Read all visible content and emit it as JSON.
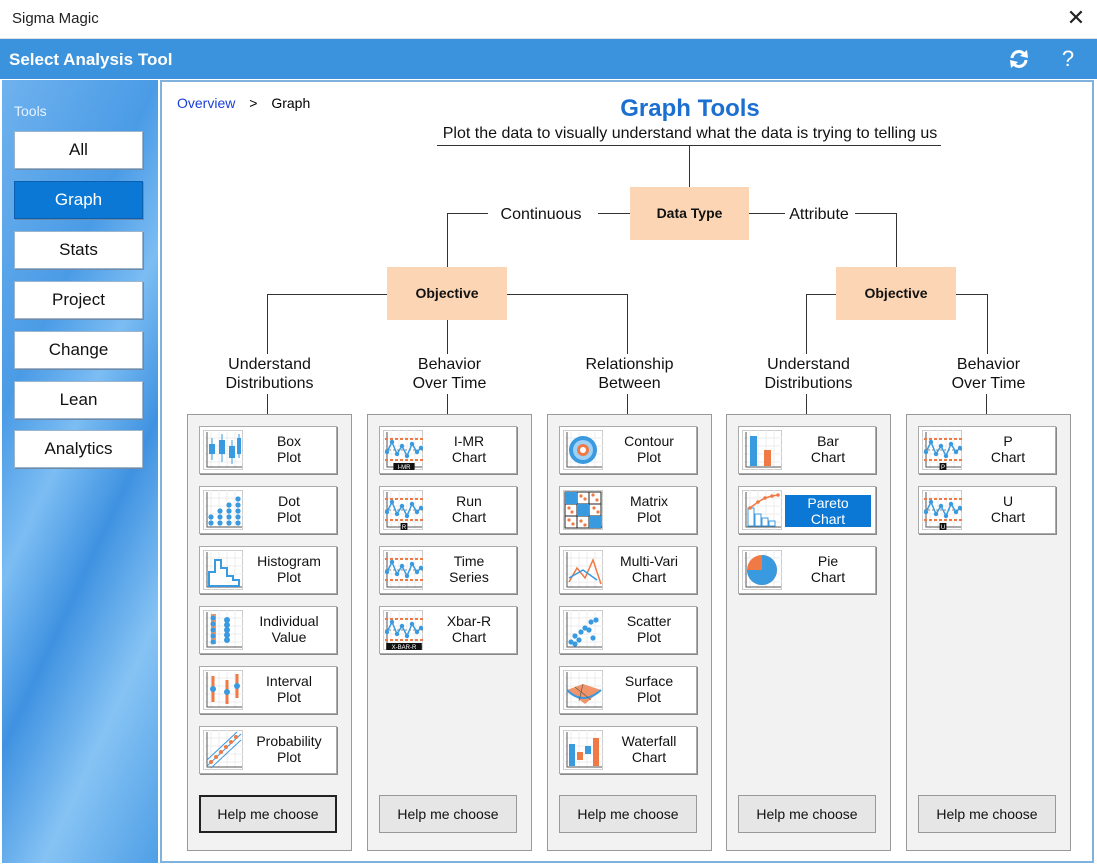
{
  "window": {
    "title": "Sigma Magic",
    "close_glyph": "✕"
  },
  "header": {
    "title": "Select Analysis Tool",
    "refresh_glyph": "⟳",
    "help_glyph": "?"
  },
  "sidebar": {
    "label": "Tools",
    "items": [
      {
        "label": "All"
      },
      {
        "label": "Graph",
        "active": true
      },
      {
        "label": "Stats"
      },
      {
        "label": "Project"
      },
      {
        "label": "Change"
      },
      {
        "label": "Lean"
      },
      {
        "label": "Analytics"
      }
    ]
  },
  "breadcrumb": {
    "root": "Overview",
    "separator": ">",
    "current": "Graph"
  },
  "main": {
    "title": "Graph Tools",
    "subtitle": "Plot the data to visually understand what the data is trying to telling us",
    "data_type": "Data Type",
    "continuous": "Continuous",
    "attribute": "Attribute",
    "objective": "Objective",
    "help_label": "Help me choose",
    "colors": {
      "accent": "#3b93dd",
      "box": "#fcd6b4",
      "selected": "#0a78d4",
      "title": "#1a6fd0"
    },
    "groups": [
      {
        "heading_1": "Understand",
        "heading_2": "Distributions",
        "tools": [
          {
            "line1": "Box",
            "line2": "Plot",
            "icon": "box-plot-icon"
          },
          {
            "line1": "Dot",
            "line2": "Plot",
            "icon": "dot-plot-icon"
          },
          {
            "line1": "Histogram",
            "line2": "Plot",
            "icon": "histogram-icon"
          },
          {
            "line1": "Individual",
            "line2": "Value",
            "icon": "individual-value-icon"
          },
          {
            "line1": "Interval",
            "line2": "Plot",
            "icon": "interval-plot-icon"
          },
          {
            "line1": "Probability",
            "line2": "Plot",
            "icon": "probability-plot-icon"
          }
        ]
      },
      {
        "heading_1": "Behavior",
        "heading_2": "Over Time",
        "tools": [
          {
            "line1": "I-MR",
            "line2": "Chart",
            "icon": "control-chart-icon",
            "tag": "I-MR"
          },
          {
            "line1": "Run",
            "line2": "Chart",
            "icon": "control-chart-icon",
            "tag": "R"
          },
          {
            "line1": "Time",
            "line2": "Series",
            "icon": "control-chart-icon",
            "tag": ""
          },
          {
            "line1": "Xbar-R",
            "line2": "Chart",
            "icon": "control-chart-icon",
            "tag": "X-BAR-R"
          }
        ]
      },
      {
        "heading_1": "Relationship",
        "heading_2": "Between",
        "tools": [
          {
            "line1": "Contour",
            "line2": "Plot",
            "icon": "contour-plot-icon"
          },
          {
            "line1": "Matrix",
            "line2": "Plot",
            "icon": "matrix-plot-icon"
          },
          {
            "line1": "Multi-Vari",
            "line2": "Chart",
            "icon": "multi-vari-icon"
          },
          {
            "line1": "Scatter",
            "line2": "Plot",
            "icon": "scatter-plot-icon"
          },
          {
            "line1": "Surface",
            "line2": "Plot",
            "icon": "surface-plot-icon"
          },
          {
            "line1": "Waterfall",
            "line2": "Chart",
            "icon": "waterfall-chart-icon"
          }
        ]
      },
      {
        "heading_1": "Understand",
        "heading_2": "Distributions",
        "tools": [
          {
            "line1": "Bar",
            "line2": "Chart",
            "icon": "bar-chart-icon"
          },
          {
            "line1": "Pareto",
            "line2": "Chart",
            "icon": "pareto-chart-icon",
            "selected": true
          },
          {
            "line1": "Pie",
            "line2": "Chart",
            "icon": "pie-chart-icon"
          }
        ]
      },
      {
        "heading_1": "Behavior",
        "heading_2": "Over Time",
        "tools": [
          {
            "line1": "P",
            "line2": "Chart",
            "icon": "control-chart-icon",
            "tag": "P"
          },
          {
            "line1": "U",
            "line2": "Chart",
            "icon": "control-chart-icon",
            "tag": "U"
          }
        ]
      }
    ]
  }
}
